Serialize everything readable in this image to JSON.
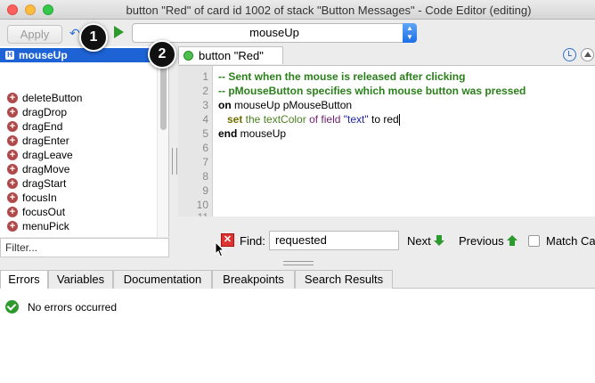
{
  "window": {
    "title": "button \"Red\" of card id 1002 of stack \"Button Messages\" - Code Editor (editing)"
  },
  "toolbar": {
    "apply_label": "Apply",
    "handler_selector_value": "mouseUp"
  },
  "callouts": [
    "1",
    "2"
  ],
  "sidebar": {
    "selected_badge": "H",
    "items": [
      {
        "label": "mouseUp",
        "selected": true
      },
      {
        "label": "deleteButton"
      },
      {
        "label": "dragDrop"
      },
      {
        "label": "dragEnd"
      },
      {
        "label": "dragEnter"
      },
      {
        "label": "dragLeave"
      },
      {
        "label": "dragMove"
      },
      {
        "label": "dragStart"
      },
      {
        "label": "focusIn"
      },
      {
        "label": "focusOut"
      },
      {
        "label": "menuPick"
      }
    ],
    "filter_placeholder": "Filter..."
  },
  "editor": {
    "tab_label": "button \"Red\"",
    "line_numbers": [
      "1",
      "2",
      "3",
      "4",
      "5",
      "6",
      "7",
      "8",
      "9",
      "10",
      "11"
    ],
    "code": {
      "line1": "-- Sent when the mouse is released after clicking",
      "line2": "-- pMouseButton specifies which mouse button was pressed",
      "line3_kw": "on",
      "line3_rest": " mouseUp pMouseButton",
      "line4_cmd": "set",
      "line4_the": " the ",
      "line4_prop": "textColor",
      "line4_of": " of ",
      "line4_obj": "field",
      "line4_sp": " ",
      "line4_str": "\"text\"",
      "line4_to": " to red",
      "line5_kw": "end",
      "line5_rest": " mouseUp"
    }
  },
  "find": {
    "label": "Find:",
    "value": "requested",
    "next_label": "Next",
    "previous_label": "Previous",
    "match_label": "Match Ca"
  },
  "bottom_tabs": [
    {
      "label": "Errors",
      "active": true
    },
    {
      "label": "Variables"
    },
    {
      "label": "Documentation"
    },
    {
      "label": "Breakpoints"
    },
    {
      "label": "Search Results"
    }
  ],
  "status": {
    "message": "No errors occurred"
  },
  "colors": {
    "selection": "#1d63d6",
    "comment": "#2a7f1a",
    "ok": "#2e9a2e"
  }
}
